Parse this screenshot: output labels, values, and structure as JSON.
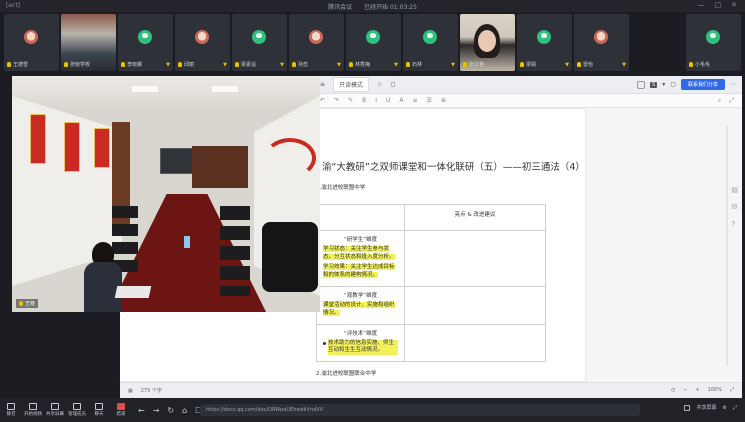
{
  "titlebar": {
    "app_mark": "[ect]",
    "title": "腾讯会议",
    "subtitle": "已经开始 01:03:25",
    "controls": [
      "—",
      "□",
      "✕"
    ]
  },
  "participants": [
    {
      "name": "王德雪",
      "type": "avatar-photo"
    },
    {
      "name": "张晓学校",
      "type": "camera-1"
    },
    {
      "name": "李晓娜",
      "type": "avatar"
    },
    {
      "name": "邱丽",
      "type": "avatar-photo"
    },
    {
      "name": "梁素遥",
      "type": "avatar"
    },
    {
      "name": "孙蕊",
      "type": "avatar-photo"
    },
    {
      "name": "林秀梅",
      "type": "avatar"
    },
    {
      "name": "石林",
      "type": "avatar"
    },
    {
      "name": "张文艳",
      "type": "camera-2"
    },
    {
      "name": "梁娟",
      "type": "avatar"
    },
    {
      "name": "雷怡",
      "type": "avatar-photo"
    },
    {
      "name": "小毛毛",
      "type": "avatar"
    }
  ],
  "camera": {
    "label": "王晓"
  },
  "doc": {
    "tab_name": "只读模式",
    "page_count": "5",
    "share_label": "联系我们分享",
    "title": "渝“大教研”之双师课堂和一体化联研（五）——初三通法（4）",
    "section_1": "1.渝北进校联盟中学",
    "section_2": "2.渝北进校联盟联合中学",
    "table": {
      "header_right": "亮点 & 改进建议",
      "rows": [
        {
          "title": "“研学生”维度",
          "items": [
            "学习状态：关注学生参与状态，分互状态和投入度分析。",
            "学习效果：关注学生达成目标和的体系的建构情况。"
          ]
        },
        {
          "title": "“观教学”维度",
          "items": [
            "课堂活动的设计、实施和组织情况。"
          ]
        },
        {
          "title": "“评技术”维度",
          "items": [
            "技术助力的信息实施、师生互动和生生互动情况。"
          ]
        }
      ]
    },
    "status_left": "275 个字",
    "status_zoom": "100%"
  },
  "bottombar": {
    "controls": [
      "静音",
      "开始视频",
      "共享屏幕",
      "管理成员",
      "聊天",
      "结束"
    ],
    "url": "https://docs.qq.com/doc/DRWpaUEhwbkVndVV",
    "settings_label": "共享屏幕"
  },
  "colors": {
    "highlight": "#f4f05a",
    "accent": "#2e6be6",
    "avatar": "#2fbf7f",
    "mic": "#e6c200",
    "end": "#e04b4b"
  }
}
